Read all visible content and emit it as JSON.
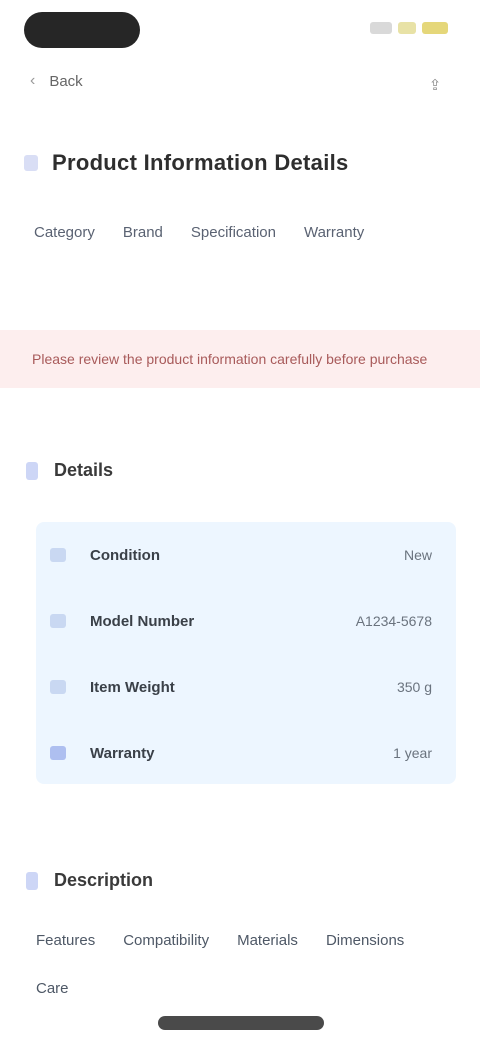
{
  "nav": {
    "back_label": "Back",
    "action_label": "Share",
    "action_icon": "share-icon"
  },
  "title": "Product Information Details",
  "tags": [
    "Category",
    "Brand",
    "Specification",
    "Warranty"
  ],
  "alert": {
    "text": "Please review the product information carefully before purchase"
  },
  "details": {
    "heading": "Details",
    "rows": [
      {
        "label": "Condition",
        "value": "New"
      },
      {
        "label": "Model Number",
        "value": "A1234-5678"
      },
      {
        "label": "Item Weight",
        "value": "350 g"
      },
      {
        "label": "Warranty",
        "value": "1 year"
      }
    ]
  },
  "description": {
    "heading": "Description",
    "links": [
      "Features",
      "Compatibility",
      "Materials",
      "Dimensions",
      "Care"
    ]
  },
  "colors": {
    "alert_bg": "#fdeeee",
    "list_bg": "#edf6ff",
    "accent": "#cdd6f6"
  }
}
